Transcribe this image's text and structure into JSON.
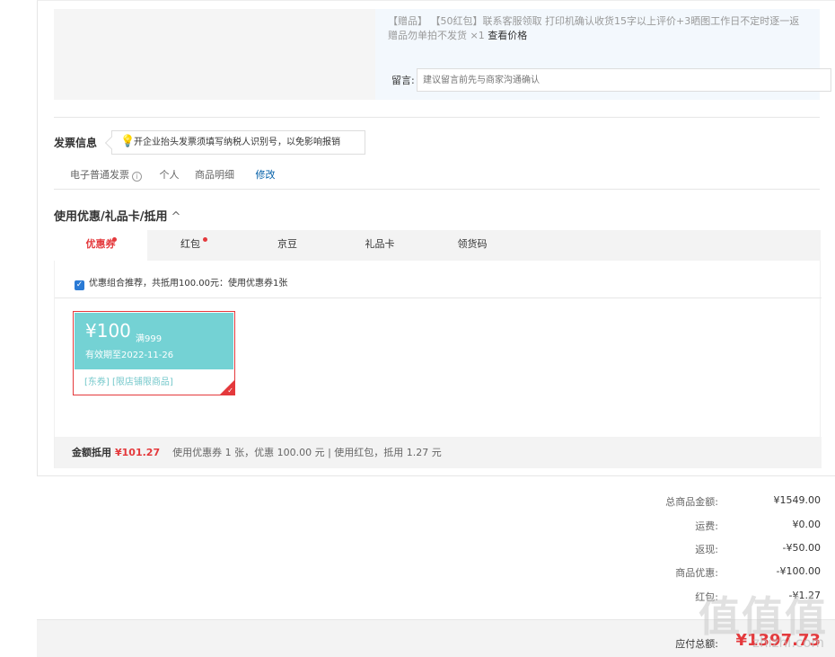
{
  "gift": {
    "text": "【赠品】 【50红包】联系客服领取 打印机确认收货15字以上评价+3晒图工作日不定时逐一返 赠品勿单拍不发货 ×1",
    "price_link": "查看价格",
    "message_label": "留言:",
    "message_placeholder": "建议留言前先与商家沟通确认"
  },
  "invoice": {
    "title": "发票信息",
    "tip": "开企业抬头发票须填写纳税人识别号，以免影响报销",
    "type": "电子普通发票",
    "info_icon": "i",
    "holder": "个人",
    "content": "商品明细",
    "edit": "修改"
  },
  "promo": {
    "title": "使用优惠/礼品卡/抵用",
    "toggle_icon": "^",
    "tabs": [
      {
        "label": "优惠券"
      },
      {
        "label": "红包"
      },
      {
        "label": "京豆"
      },
      {
        "label": "礼品卡"
      },
      {
        "label": "领货码"
      }
    ],
    "combo_text": "优惠组合推荐，共抵用100.00元：使用优惠券1张",
    "coupon": {
      "amount": "¥100",
      "condition": "满999",
      "expiry": "有效期至2022-11-26",
      "tags": "[东券] [限店铺限商品]"
    },
    "summary": {
      "label": "金额抵用",
      "amount": "¥101.27",
      "detail": "使用优惠券 1 张，优惠 100.00 元 | 使用红包，抵用 1.27 元"
    }
  },
  "totals": [
    {
      "label": "总商品金额:",
      "value": "¥1549.00"
    },
    {
      "label": "运费:",
      "value": "¥0.00"
    },
    {
      "label": "返现:",
      "value": "-¥50.00"
    },
    {
      "label": "商品优惠:",
      "value": "-¥100.00"
    },
    {
      "label": "红包:",
      "value": "-¥1.27"
    }
  ],
  "payable": {
    "label": "应付总额:",
    "amount": "¥1397.73"
  },
  "watermark": {
    "logo": "值值值",
    "site": "zhizhi.com"
  },
  "colors": {
    "accent_red": "#e4393c",
    "coupon_teal": "#74d2d4",
    "link_blue": "#005ea7"
  }
}
